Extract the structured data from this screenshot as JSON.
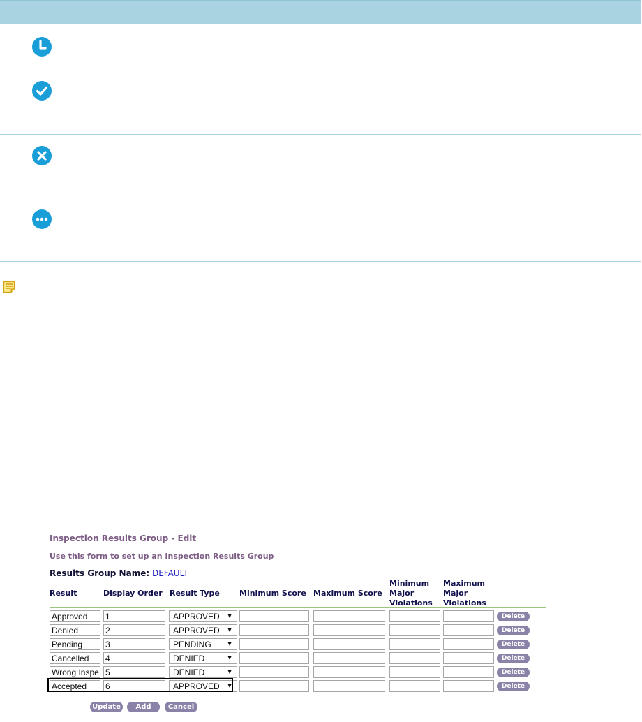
{
  "icon_table": {
    "rows": [
      {
        "icon": "clock-icon",
        "color": "#1a9ed8"
      },
      {
        "icon": "check-circle-icon",
        "color": "#1a9ed8"
      },
      {
        "icon": "x-circle-icon",
        "color": "#1a9ed8"
      },
      {
        "icon": "ellipsis-circle-icon",
        "color": "#1a9ed8"
      }
    ]
  },
  "note_icon": "note-icon",
  "form": {
    "title": "Inspection Results Group - Edit",
    "subtitle": "Use this form to set up an Inspection Results Group",
    "group_name_label": "Results Group Name:",
    "group_name_value": "DEFAULT",
    "headers": {
      "result": "Result",
      "display_order": "Display Order",
      "result_type": "Result Type",
      "min_score": "Minimum Score",
      "max_score": "Maximum Score",
      "min_major_1": "Minimum",
      "min_major_2": "Major",
      "min_major_3": "Violations",
      "max_major_1": "Maximum",
      "max_major_2": "Major",
      "max_major_3": "Violations"
    },
    "rows": [
      {
        "result": "Approved",
        "order": "1",
        "type": "APPROVED",
        "min_score": "",
        "max_score": "",
        "min_major": "",
        "max_major": "",
        "delete": "Delete"
      },
      {
        "result": "Denied",
        "order": "2",
        "type": "APPROVED",
        "min_score": "",
        "max_score": "",
        "min_major": "",
        "max_major": "",
        "delete": "Delete"
      },
      {
        "result": "Pending",
        "order": "3",
        "type": "PENDING",
        "min_score": "",
        "max_score": "",
        "min_major": "",
        "max_major": "",
        "delete": "Delete"
      },
      {
        "result": "Cancelled",
        "order": "4",
        "type": "DENIED",
        "min_score": "",
        "max_score": "",
        "min_major": "",
        "max_major": "",
        "delete": "Delete"
      },
      {
        "result": "Wrong Inspe",
        "order": "5",
        "type": "DENIED",
        "min_score": "",
        "max_score": "",
        "min_major": "",
        "max_major": "",
        "delete": "Delete"
      },
      {
        "result": "Accepted",
        "order": "6",
        "type": "APPROVED",
        "min_score": "",
        "max_score": "",
        "min_major": "",
        "max_major": "",
        "delete": "Delete"
      }
    ],
    "buttons": {
      "update": "Update",
      "add": "Add",
      "cancel": "Cancel"
    },
    "arrow": "▼"
  }
}
